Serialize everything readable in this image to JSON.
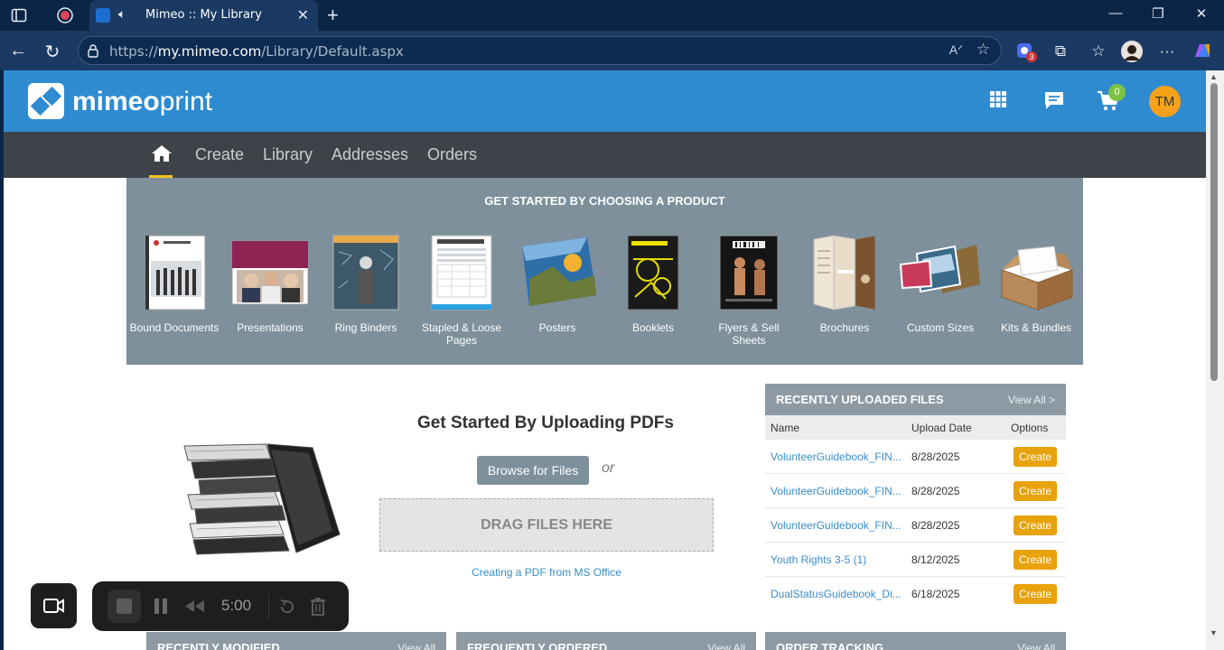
{
  "browser": {
    "tab_title": "Mimeo :: My Library",
    "url_prefix": "https://",
    "url_host": "my.mimeo.com",
    "url_path": "/Library/Default.aspx",
    "extension_badge": "3"
  },
  "header": {
    "logo_bold": "mimeo",
    "logo_light": "print",
    "cart_count": "0",
    "avatar_initials": "TM"
  },
  "nav": {
    "items": [
      "Create",
      "Library",
      "Addresses",
      "Orders"
    ]
  },
  "products": {
    "title": "GET STARTED BY CHOOSING A PRODUCT",
    "items": [
      "Bound Documents",
      "Presentations",
      "Ring Binders",
      "Stapled & Loose Pages",
      "Posters",
      "Booklets",
      "Flyers & Sell Sheets",
      "Brochures",
      "Custom Sizes",
      "Kits & Bundles"
    ]
  },
  "upload": {
    "title": "Get Started By Uploading PDFs",
    "browse_label": "Browse for Files",
    "or_label": "or",
    "drop_label": "DRAG FILES HERE",
    "pdf_link": "Creating a PDF from MS Office"
  },
  "recent": {
    "title": "RECENTLY UPLOADED FILES",
    "view_all": "View All >",
    "columns": [
      "Name",
      "Upload Date",
      "Options"
    ],
    "rows": [
      {
        "name": "VolunteerGuidebook_FIN...",
        "date": "8/28/2025",
        "action": "Create"
      },
      {
        "name": "VolunteerGuidebook_FIN...",
        "date": "8/28/2025",
        "action": "Create"
      },
      {
        "name": "VolunteerGuidebook_FIN...",
        "date": "8/28/2025",
        "action": "Create"
      },
      {
        "name": "Youth Rights 3-5 (1)",
        "date": "8/12/2025",
        "action": "Create"
      },
      {
        "name": "DualStatusGuidebook_Di...",
        "date": "6/18/2025",
        "action": "Create"
      }
    ]
  },
  "bottom_panels": [
    {
      "title": "RECENTLY MODIFIED",
      "view_all": "View All"
    },
    {
      "title": "FREQUENTLY ORDERED",
      "view_all": "View All"
    },
    {
      "title": "ORDER TRACKING",
      "view_all": "View All"
    }
  ],
  "recorder": {
    "timer": "5:00"
  },
  "colors": {
    "header_blue": "#2f8bd0",
    "nav_dark": "#3d4348",
    "band_gray": "#7d909b",
    "create_orange": "#e8a20c",
    "link_blue": "#3a8dc9",
    "cart_green": "#7cc242",
    "avatar_orange": "#f6a21a"
  }
}
